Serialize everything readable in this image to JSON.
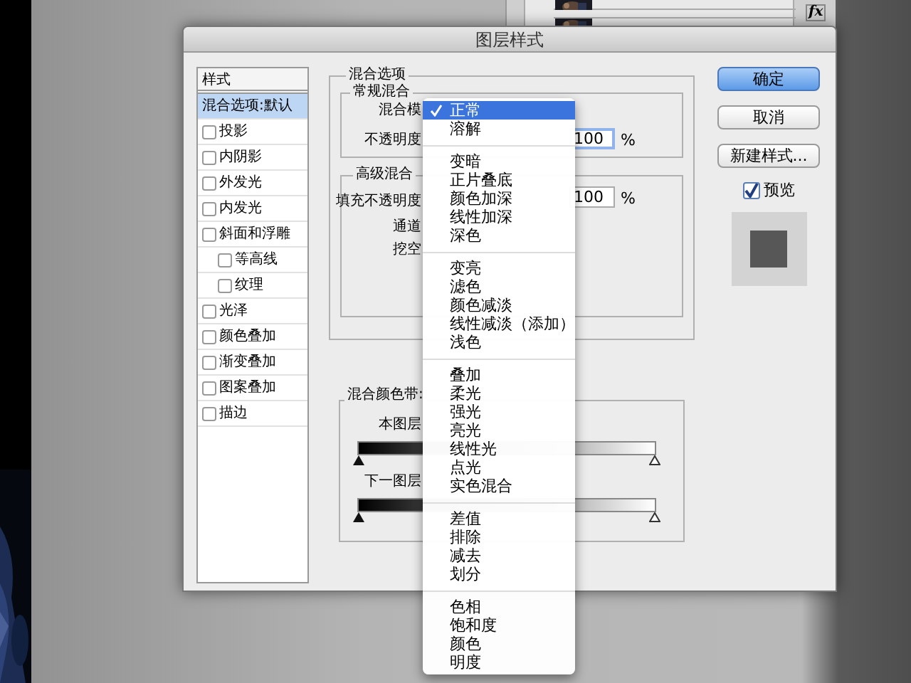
{
  "dialog": {
    "title": "图层样式"
  },
  "styles": {
    "header": "样式",
    "items": [
      {
        "label": "混合选项:默认",
        "kind": "option",
        "selected": true
      },
      {
        "label": "投影",
        "kind": "checkbox",
        "selected": false,
        "checked": false
      },
      {
        "label": "内阴影",
        "kind": "checkbox",
        "selected": false,
        "checked": false
      },
      {
        "label": "外发光",
        "kind": "checkbox",
        "selected": false,
        "checked": false
      },
      {
        "label": "内发光",
        "kind": "checkbox",
        "selected": false,
        "checked": false
      },
      {
        "label": "斜面和浮雕",
        "kind": "checkbox",
        "selected": false,
        "checked": false,
        "children": [
          {
            "label": "等高线",
            "kind": "checkbox",
            "selected": false,
            "checked": false
          },
          {
            "label": "纹理",
            "kind": "checkbox",
            "selected": false,
            "checked": false
          }
        ]
      },
      {
        "label": "光泽",
        "kind": "checkbox",
        "selected": false,
        "checked": false
      },
      {
        "label": "颜色叠加",
        "kind": "checkbox",
        "selected": false,
        "checked": false
      },
      {
        "label": "渐变叠加",
        "kind": "checkbox",
        "selected": false,
        "checked": false
      },
      {
        "label": "图案叠加",
        "kind": "checkbox",
        "selected": false,
        "checked": false
      },
      {
        "label": "描边",
        "kind": "checkbox",
        "selected": false,
        "checked": false
      }
    ]
  },
  "blending_options": {
    "title": "混合选项",
    "general": {
      "title": "常规混合",
      "blend_mode_label": "混合模",
      "opacity_label": "不透明度",
      "opacity_value": "100",
      "opacity_unit": "%"
    },
    "advanced": {
      "title": "高级混合",
      "fill_label": "填充不透明度",
      "fill_value": "100",
      "fill_unit": "%",
      "channels_label": "通道",
      "knockout_label": "挖空"
    },
    "blend_if": {
      "title": "混合颜色带:",
      "sliders": [
        {
          "label": "本图层",
          "level": 1
        },
        {
          "label": "下一图层",
          "level": 1
        }
      ]
    }
  },
  "buttons": [
    {
      "label": "确定",
      "kind": "default"
    },
    {
      "label": "取消",
      "kind": "normal"
    },
    {
      "label": "新建样式...",
      "kind": "normal"
    }
  ],
  "preview": {
    "label": "预览",
    "checked": true
  },
  "blend_menu": {
    "groups": [
      [
        {
          "label": "正常",
          "selected": true
        },
        {
          "label": "溶解",
          "selected": false
        }
      ],
      [
        {
          "label": "变暗",
          "selected": false
        },
        {
          "label": "正片叠底",
          "selected": false
        },
        {
          "label": "颜色加深",
          "selected": false
        },
        {
          "label": "线性加深",
          "selected": false
        },
        {
          "label": "深色",
          "selected": false
        }
      ],
      [
        {
          "label": "变亮",
          "selected": false
        },
        {
          "label": "滤色",
          "selected": false
        },
        {
          "label": "颜色减淡",
          "selected": false
        },
        {
          "label": "线性减淡（添加）",
          "selected": false
        },
        {
          "label": "浅色",
          "selected": false
        }
      ],
      [
        {
          "label": "叠加",
          "selected": false
        },
        {
          "label": "柔光",
          "selected": false
        },
        {
          "label": "强光",
          "selected": false
        },
        {
          "label": "亮光",
          "selected": false
        },
        {
          "label": "线性光",
          "selected": false
        },
        {
          "label": "点光",
          "selected": false
        },
        {
          "label": "实色混合",
          "selected": false
        }
      ],
      [
        {
          "label": "差值",
          "selected": false
        },
        {
          "label": "排除",
          "selected": false
        },
        {
          "label": "减去",
          "selected": false
        },
        {
          "label": "划分",
          "selected": false
        }
      ],
      [
        {
          "label": "色相",
          "selected": false
        },
        {
          "label": "饱和度",
          "selected": false
        },
        {
          "label": "颜色",
          "selected": false
        },
        {
          "label": "明度",
          "selected": false
        }
      ]
    ]
  },
  "layers_panel": {
    "fx": "fx"
  }
}
